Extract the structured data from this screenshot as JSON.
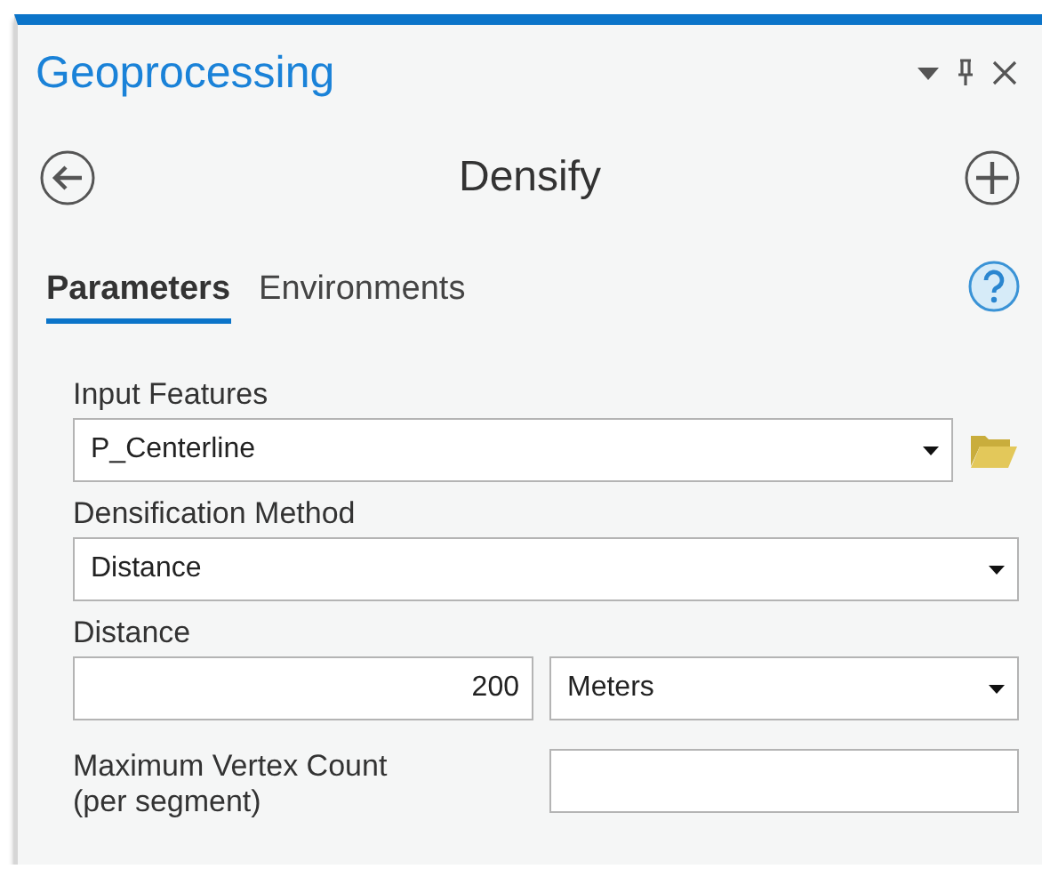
{
  "panel": {
    "title": "Geoprocessing"
  },
  "tool": {
    "name": "Densify"
  },
  "tabs": [
    {
      "label": "Parameters",
      "selected": true
    },
    {
      "label": "Environments",
      "selected": false
    }
  ],
  "parameters": [
    {
      "kind": "dataset",
      "label": "Input Features",
      "value": "P_Centerline"
    },
    {
      "kind": "choice",
      "label": "Densification Method",
      "value": "Distance"
    },
    {
      "kind": "linear_unit",
      "label": "Distance",
      "value": "200",
      "unit": "Meters"
    },
    {
      "kind": "number",
      "label": "Maximum Vertex Count (per segment)"
    }
  ]
}
